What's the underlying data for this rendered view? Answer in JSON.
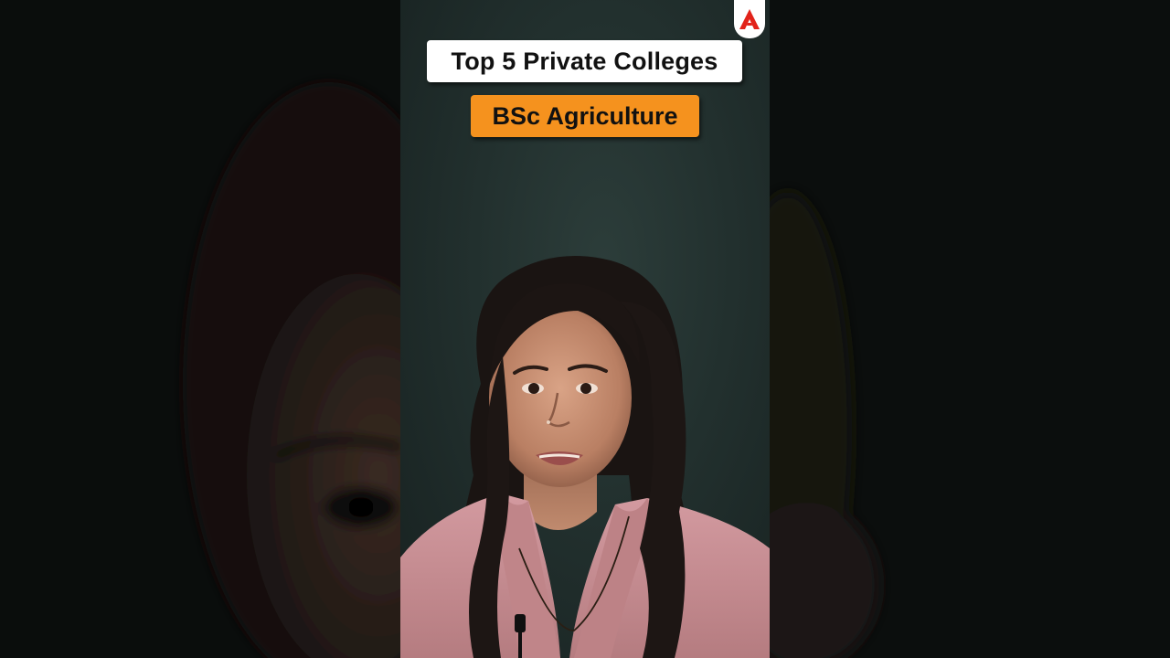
{
  "overlay": {
    "title": "Top 5 Private Colleges",
    "subtitle": "BSc Agriculture"
  },
  "brand": {
    "logo_icon": "adda-a-logo-icon",
    "logo_color": "#e2231a"
  },
  "colors": {
    "title_bg": "#ffffff",
    "subtitle_bg": "#f5921e",
    "backdrop": "#22302e",
    "shirt": "#c98f93"
  }
}
